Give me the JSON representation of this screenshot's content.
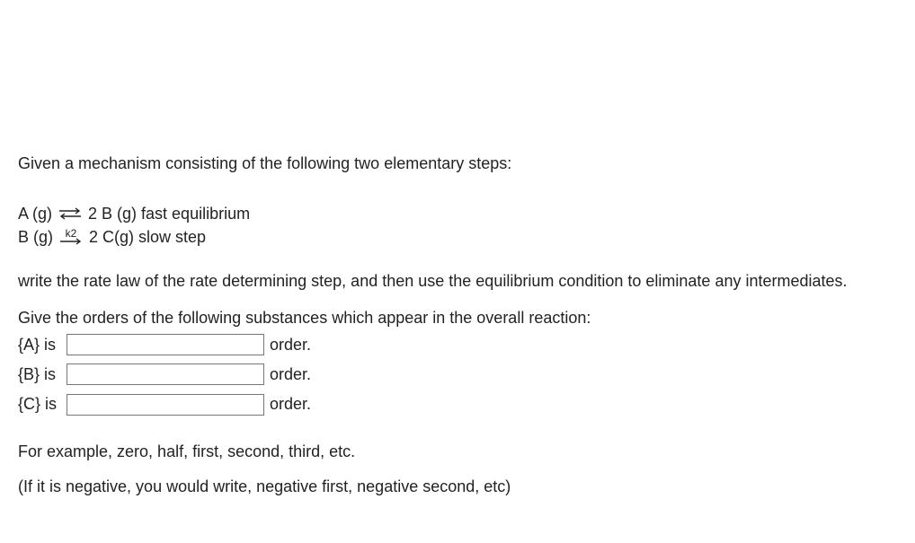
{
  "intro": "Given a mechanism consisting of the following two elementary steps:",
  "step1": {
    "lhs": "A (g)",
    "rhs": "2 B (g) fast equilibrium"
  },
  "step2": {
    "lhs": "B (g)",
    "k_label": "k2",
    "rhs": "2 C(g) slow step"
  },
  "rate_law_instruction": "write the rate law of the rate determining step, and then use the equilibrium condition to eliminate any intermediates.",
  "order_prompt": "Give the orders of the following substances which appear in the overall reaction:",
  "orders": {
    "A": {
      "label": "{A} is",
      "value": "",
      "suffix": "order."
    },
    "B": {
      "label": "{B} is",
      "value": "",
      "suffix": "order."
    },
    "C": {
      "label": "{C} is",
      "value": "",
      "suffix": "order."
    }
  },
  "example_line": "For example, zero, half, first, second, third, etc.",
  "negative_line": "(If it is negative, you would write, negative first, negative second, etc)"
}
